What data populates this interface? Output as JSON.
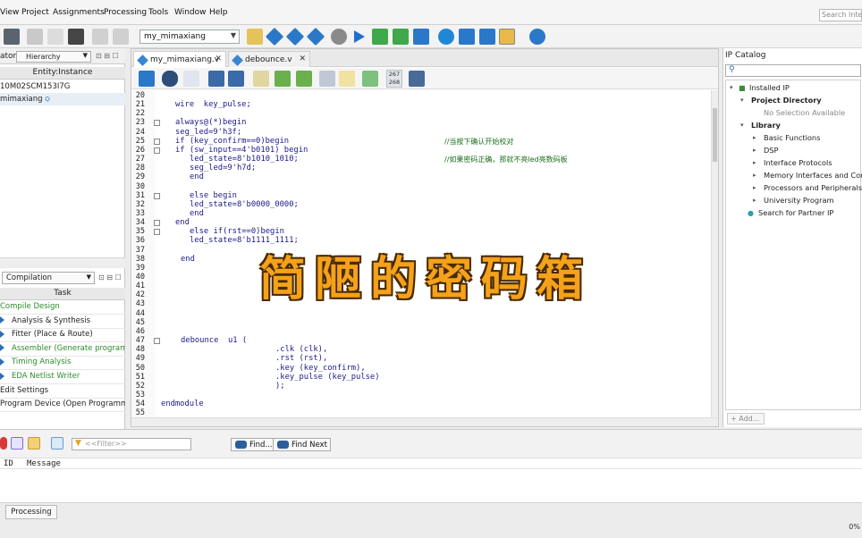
{
  "menu": [
    "View",
    "Project",
    "Assignments",
    "Processing",
    "Tools",
    "Window",
    "Help"
  ],
  "search": {
    "placeholder": "Search Intel"
  },
  "toolbar": {
    "project": "my_mimaxiang"
  },
  "left_top": {
    "title_fragment": "ator",
    "hierarchy_label": "Hierarchy",
    "entity_header": "Entity:Instance",
    "device": "10M02SCM153I7G",
    "top_entity": "mimaxiang"
  },
  "left_bottom": {
    "flow": "Compilation",
    "task_header": "Task",
    "tasks": [
      {
        "label": "Compile Design",
        "color": "#2e8b2e",
        "arrow": false
      },
      {
        "label": "Analysis & Synthesis",
        "color": "#222",
        "arrow": true
      },
      {
        "label": "Fitter (Place & Route)",
        "color": "#222",
        "arrow": true
      },
      {
        "label": "Assembler (Generate programming",
        "color": "#2e8b2e",
        "arrow": true
      },
      {
        "label": "Timing Analysis",
        "color": "#2e8b2e",
        "arrow": true
      },
      {
        "label": "EDA Netlist Writer",
        "color": "#2e8b2e",
        "arrow": true
      },
      {
        "label": "Edit Settings",
        "color": "#222",
        "arrow": false
      },
      {
        "label": "Program Device (Open Programmer)",
        "color": "#222",
        "arrow": false
      }
    ]
  },
  "editor": {
    "tabs": [
      {
        "label": "my_mimaxiang.v"
      },
      {
        "label": "debounce.v"
      }
    ],
    "line_badge_top": "267",
    "line_badge_bottom": "268",
    "line_numbers": [
      "20",
      "21",
      "22",
      "23",
      "24",
      "25",
      "26",
      "27",
      "28",
      "29",
      "30",
      "31",
      "32",
      "33",
      "34",
      "35",
      "36",
      "37",
      "38",
      "39",
      "40",
      "41",
      "42",
      "43",
      "44",
      "45",
      "46",
      "47",
      "48",
      "49",
      "50",
      "51",
      "52",
      "53",
      "54",
      "55"
    ],
    "code": [
      {
        "line": 1,
        "indent": 26,
        "text": "wire  key_pulse;"
      },
      {
        "line": 3,
        "indent": 26,
        "text": "always@(*)begin"
      },
      {
        "line": 4,
        "indent": 26,
        "text": "seg_led=9'h3f;"
      },
      {
        "line": 5,
        "indent": 26,
        "text": "if (key_confirm==0)begin"
      },
      {
        "line": 6,
        "indent": 26,
        "text": "if (sw_input==4'b0101) begin"
      },
      {
        "line": 7,
        "indent": 42,
        "text": "led_state=8'b1010_1010;"
      },
      {
        "line": 8,
        "indent": 42,
        "text": "seg_led=9'h7d;"
      },
      {
        "line": 9,
        "indent": 42,
        "text": "end"
      },
      {
        "line": 11,
        "indent": 42,
        "text": "else begin"
      },
      {
        "line": 12,
        "indent": 42,
        "text": "led_state=8'b0000_0000;"
      },
      {
        "line": 13,
        "indent": 42,
        "text": "end"
      },
      {
        "line": 14,
        "indent": 26,
        "text": "end"
      },
      {
        "line": 15,
        "indent": 42,
        "text": "else if(rst==0)begin"
      },
      {
        "line": 16,
        "indent": 42,
        "text": "led_state=8'b1111_1111;"
      },
      {
        "line": 18,
        "indent": 32,
        "text": "end"
      },
      {
        "line": 27,
        "indent": 32,
        "text": "debounce  u1 ("
      },
      {
        "line": 28,
        "indent": 138,
        "text": ".clk (clk),"
      },
      {
        "line": 29,
        "indent": 138,
        "text": ".rst (rst),"
      },
      {
        "line": 30,
        "indent": 138,
        "text": ".key (key_confirm),"
      },
      {
        "line": 31,
        "indent": 138,
        "text": ".key_pulse (key_pulse)"
      },
      {
        "line": 32,
        "indent": 138,
        "text": ");"
      },
      {
        "line": 34,
        "indent": 10,
        "text": "endmodule"
      }
    ],
    "comments": [
      {
        "line": 5,
        "text": "//当按下确认开始校对"
      },
      {
        "line": 7,
        "text": "//如果密码正确，那就不亮led亮数码板"
      }
    ]
  },
  "overlay_caption": "简陋的密码箱",
  "ip_catalog": {
    "title": "IP Catalog",
    "rows": [
      {
        "label": "Installed IP",
        "indent": 16,
        "arrow": "▾",
        "bold": false,
        "muted": false
      },
      {
        "label": "Project Directory",
        "indent": 28,
        "arrow": "▾",
        "bold": true,
        "muted": false
      },
      {
        "label": "No Selection Available",
        "indent": 42,
        "arrow": "",
        "bold": false,
        "muted": true
      },
      {
        "label": "Library",
        "indent": 28,
        "arrow": "▾",
        "bold": true,
        "muted": false
      },
      {
        "label": "Basic Functions",
        "indent": 42,
        "arrow": "▸",
        "bold": false,
        "muted": false
      },
      {
        "label": "DSP",
        "indent": 42,
        "arrow": "▸",
        "bold": false,
        "muted": false
      },
      {
        "label": "Interface Protocols",
        "indent": 42,
        "arrow": "▸",
        "bold": false,
        "muted": false
      },
      {
        "label": "Memory Interfaces and Controllers",
        "indent": 42,
        "arrow": "▸",
        "bold": false,
        "muted": false
      },
      {
        "label": "Processors and Peripherals",
        "indent": 42,
        "arrow": "▸",
        "bold": false,
        "muted": false
      },
      {
        "label": "University Program",
        "indent": 42,
        "arrow": "▸",
        "bold": false,
        "muted": false
      },
      {
        "label": "Search for Partner IP",
        "indent": 26,
        "arrow": "",
        "bold": false,
        "muted": false
      }
    ],
    "add_label": "+ Add..."
  },
  "messages": {
    "filter_placeholder": "<<Filter>>",
    "find_label": "Find...",
    "find_next_label": "Find Next",
    "col_id": "ID",
    "col_message": "Message"
  },
  "bottom": {
    "tab": "Processing",
    "status": "0%"
  }
}
